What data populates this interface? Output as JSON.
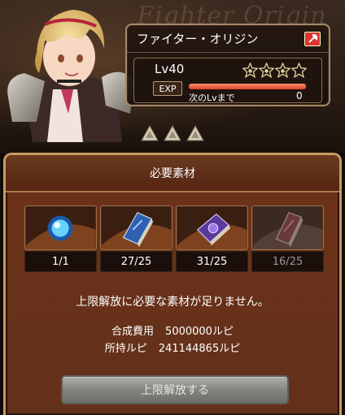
{
  "hero": {
    "bg_title": "Fighter Origin",
    "job_name": "ファイター・オリジン",
    "level": "Lv40",
    "stars": {
      "filled": 3,
      "total": 4
    },
    "exp_label": "EXP",
    "exp_progress": 1.0,
    "next_label": "次のLvまで",
    "next_value": "0",
    "uncap_count": 3
  },
  "panel": {
    "title": "必要素材",
    "materials": [
      {
        "icon": "blue-orb-icon",
        "count": "1/1",
        "available": true
      },
      {
        "icon": "blue-tome-icon",
        "count": "27/25",
        "available": true
      },
      {
        "icon": "purple-tome-icon",
        "count": "31/25",
        "available": true
      },
      {
        "icon": "red-tome-icon",
        "count": "16/25",
        "available": false
      }
    ],
    "message": "上限解放に必要な素材が足りません。",
    "cost_label": "合成費用",
    "cost_value": "5000000ルピ",
    "owned_label": "所持ルピ",
    "owned_value": "241144865ルピ",
    "button_label": "上限解放する"
  },
  "colors": {
    "panel_border": "#c89a62",
    "panel_bg": "#63301a",
    "exp_fill": "#d84428",
    "button_disabled": "#858580"
  }
}
